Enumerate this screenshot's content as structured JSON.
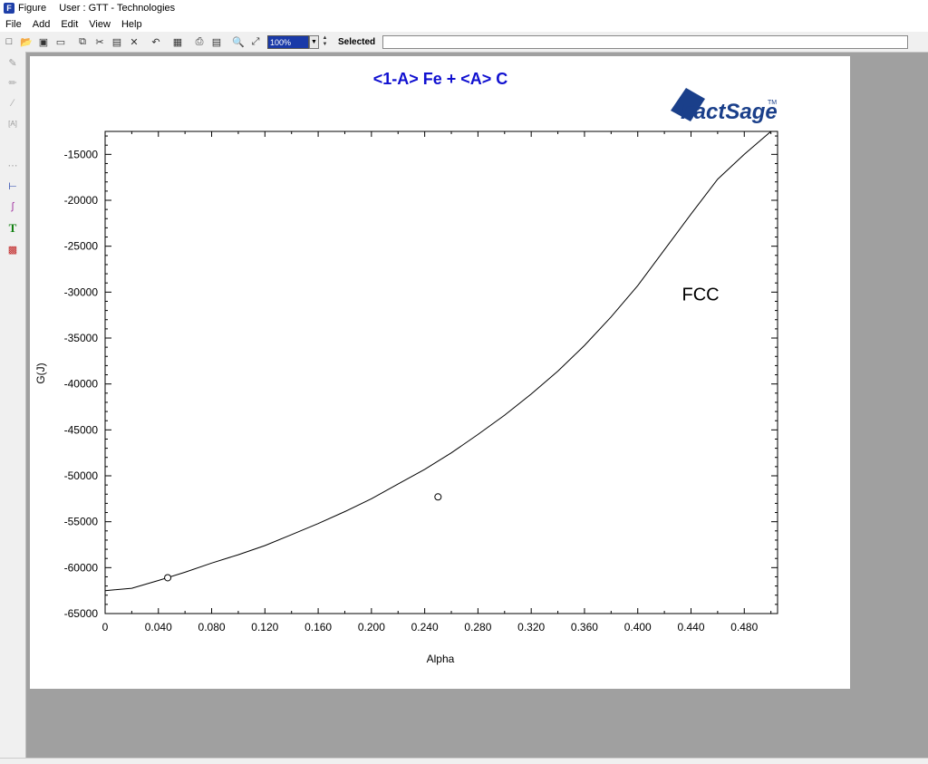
{
  "window": {
    "title": "Figure",
    "user": "User : GTT - Technologies"
  },
  "menu": [
    "File",
    "Add",
    "Edit",
    "View",
    "Help"
  ],
  "toolbar": {
    "icons": [
      "new-icon",
      "open-icon",
      "save-icon",
      "folder-icon",
      "copy-icon",
      "cut-icon",
      "paste-icon",
      "delete-icon",
      "undo-icon",
      "properties-icon",
      "print-icon",
      "print-preview-icon",
      "zoom-icon",
      "fit-icon"
    ],
    "zoom_value": "100%",
    "selected_label": "Selected",
    "selected_value": ""
  },
  "left_toolbar": {
    "icons": [
      "pen-icon",
      "brush-icon",
      "line-icon",
      "text-frame-icon",
      "dashed-line-icon",
      "axis-icon",
      "curve-icon",
      "text-icon",
      "color-fill-icon"
    ]
  },
  "colors": {
    "title": "#1010d0",
    "logo": "#1a3f8a",
    "curve": "#000000"
  },
  "logo": {
    "text": "FactSage",
    "tm": "TM"
  },
  "chart_data": {
    "type": "line",
    "title": "<1-A> Fe  +  <A> C",
    "xlabel": "Alpha",
    "ylabel": "G(J)",
    "xlim": [
      0,
      0.505
    ],
    "ylim": [
      -65000,
      -12500
    ],
    "xticks": [
      "0",
      "0.040",
      "0.080",
      "0.120",
      "0.160",
      "0.200",
      "0.240",
      "0.280",
      "0.320",
      "0.360",
      "0.400",
      "0.440",
      "0.480"
    ],
    "yticks": [
      "-15000",
      "-20000",
      "-25000",
      "-30000",
      "-35000",
      "-40000",
      "-45000",
      "-50000",
      "-55000",
      "-60000",
      "-65000"
    ],
    "series": [
      {
        "name": "FCC",
        "x": [
          0,
          0.02,
          0.04,
          0.06,
          0.08,
          0.1,
          0.12,
          0.14,
          0.16,
          0.18,
          0.2,
          0.22,
          0.24,
          0.26,
          0.28,
          0.3,
          0.32,
          0.34,
          0.36,
          0.38,
          0.4,
          0.42,
          0.44,
          0.46,
          0.48,
          0.5,
          0.505
        ],
        "y": [
          -62500,
          -62250,
          -61400,
          -60500,
          -59500,
          -58600,
          -57600,
          -56400,
          -55200,
          -53900,
          -52500,
          -50900,
          -49300,
          -47500,
          -45500,
          -43400,
          -41100,
          -38600,
          -35800,
          -32700,
          -29300,
          -25400,
          -21500,
          -17700,
          -15000,
          -12500,
          -12500
        ]
      }
    ],
    "markers": [
      {
        "x": 0.047,
        "y": -61100
      },
      {
        "x": 0.25,
        "y": -52300
      }
    ],
    "annotations": [
      {
        "text": "FCC",
        "x": 0.44,
        "y": -30200
      }
    ]
  }
}
